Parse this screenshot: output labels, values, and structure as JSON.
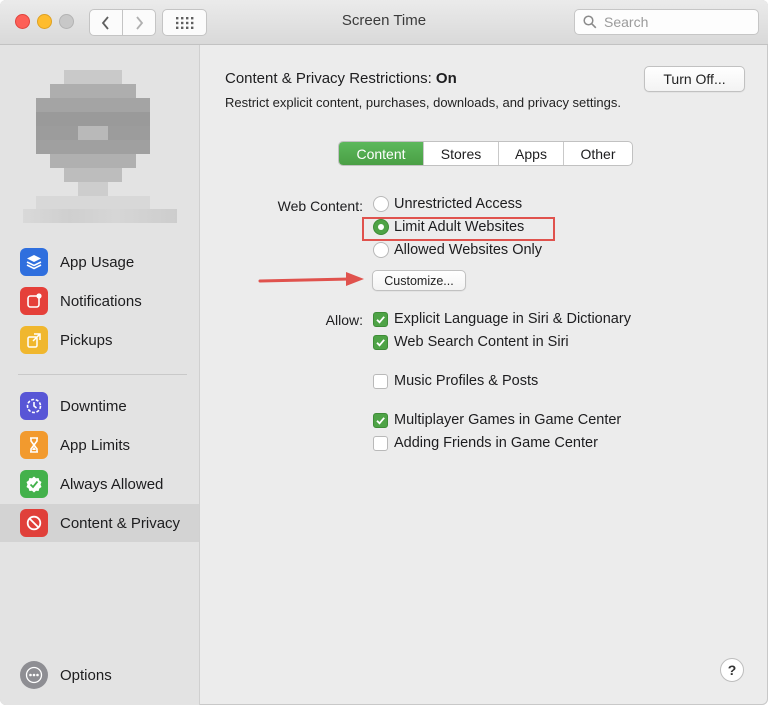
{
  "window": {
    "title": "Screen Time"
  },
  "search": {
    "placeholder": "Search"
  },
  "sidebar": {
    "items": [
      {
        "label": "App Usage",
        "icon": "app-usage-icon",
        "color": "#2f6fde"
      },
      {
        "label": "Notifications",
        "icon": "notifications-icon",
        "color": "#e5403a"
      },
      {
        "label": "Pickups",
        "icon": "pickups-icon",
        "color": "#f0b72e"
      },
      {
        "label": "Downtime",
        "icon": "downtime-icon",
        "color": "#5856d6"
      },
      {
        "label": "App Limits",
        "icon": "app-limits-icon",
        "color": "#f29a2e"
      },
      {
        "label": "Always Allowed",
        "icon": "always-allowed-icon",
        "color": "#43b14b"
      },
      {
        "label": "Content & Privacy",
        "icon": "content-privacy-icon",
        "color": "#e0403a",
        "selected": true
      }
    ],
    "options_label": "Options"
  },
  "main": {
    "header_prefix": "Content & Privacy Restrictions: ",
    "header_state": "On",
    "subtitle": "Restrict explicit content, purchases, downloads, and privacy settings.",
    "turn_off_label": "Turn Off...",
    "tabs": [
      {
        "label": "Content",
        "active": true
      },
      {
        "label": "Stores",
        "active": false
      },
      {
        "label": "Apps",
        "active": false
      },
      {
        "label": "Other",
        "active": false
      }
    ],
    "web_content_label": "Web Content:",
    "web_content_options": [
      {
        "label": "Unrestricted Access",
        "selected": false
      },
      {
        "label": "Limit Adult Websites",
        "selected": true
      },
      {
        "label": "Allowed Websites Only",
        "selected": false
      }
    ],
    "customize_label": "Customize...",
    "allow_label": "Allow:",
    "allow_options": [
      {
        "label": "Explicit Language in Siri & Dictionary",
        "checked": true
      },
      {
        "label": "Web Search Content in Siri",
        "checked": true
      },
      {
        "label": "Music Profiles & Posts",
        "checked": false
      },
      {
        "label": "Multiplayer Games in Game Center",
        "checked": true
      },
      {
        "label": "Adding Friends in Game Center",
        "checked": false
      }
    ],
    "help_label": "?"
  },
  "colors": {
    "accent_green": "#4ea346",
    "highlight_red": "#e0524d"
  }
}
